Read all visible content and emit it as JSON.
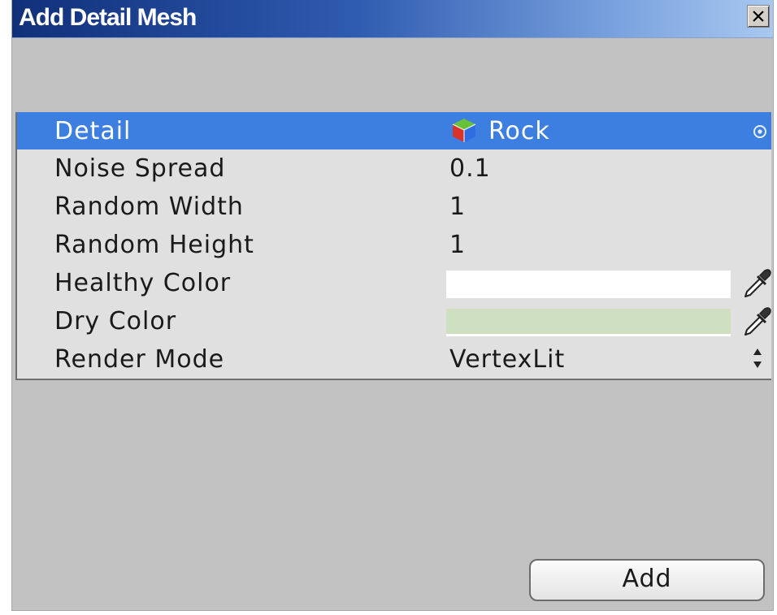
{
  "window": {
    "title": "Add Detail Mesh",
    "close_label": "×"
  },
  "fields": {
    "detail": {
      "label": "Detail",
      "value": "Rock"
    },
    "noise_spread": {
      "label": "Noise Spread",
      "value": "0.1"
    },
    "random_width": {
      "label": "Random Width",
      "value": "1"
    },
    "random_height": {
      "label": "Random Height",
      "value": "1"
    },
    "healthy_color": {
      "label": "Healthy Color",
      "color": "#ffffff"
    },
    "dry_color": {
      "label": "Dry Color",
      "color": "#cfdfc2"
    },
    "render_mode": {
      "label": "Render Mode",
      "value": "VertexLit"
    }
  },
  "actions": {
    "add_label": "Add"
  },
  "colors": {
    "selection": "#3d7fe0",
    "titlebar_start": "#10307a",
    "titlebar_end": "#a9c8ef"
  }
}
